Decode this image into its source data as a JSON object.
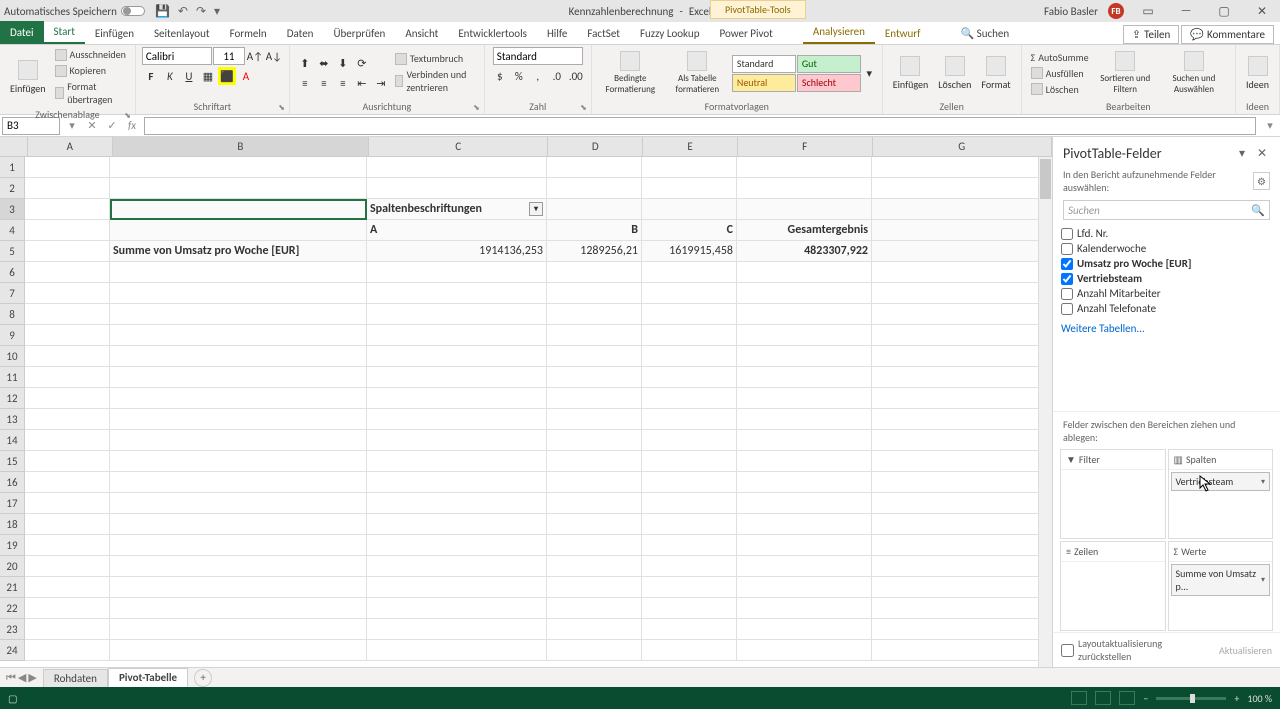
{
  "titlebar": {
    "autosave": "Automatisches Speichern",
    "docname": "Kennzahlenberechnung",
    "app": "Excel",
    "pt_tools": "PivotTable-Tools",
    "user": "Fabio Basler",
    "user_initials": "FB"
  },
  "tabs": {
    "file": "Datei",
    "items": [
      "Start",
      "Einfügen",
      "Seitenlayout",
      "Formeln",
      "Daten",
      "Überprüfen",
      "Ansicht",
      "Entwicklertools",
      "Hilfe",
      "FactSet",
      "Fuzzy Lookup",
      "Power Pivot"
    ],
    "pt_items": [
      "Analysieren",
      "Entwurf"
    ],
    "search": "Suchen",
    "share": "Teilen",
    "comments": "Kommentare"
  },
  "ribbon": {
    "clipboard": {
      "label": "Zwischenablage",
      "paste": "Einfügen",
      "cut": "Ausschneiden",
      "copy": "Kopieren",
      "fmtpaint": "Format übertragen"
    },
    "font": {
      "label": "Schriftart",
      "name": "Calibri",
      "size": "11"
    },
    "align": {
      "label": "Ausrichtung",
      "wrap": "Textumbruch",
      "merge": "Verbinden und zentrieren"
    },
    "number": {
      "label": "Zahl",
      "format": "Standard"
    },
    "styles": {
      "label": "Formatvorlagen",
      "cond": "Bedingte Formatierung",
      "astable": "Als Tabelle formatieren",
      "std": "Standard",
      "gut": "Gut",
      "neutral": "Neutral",
      "schlecht": "Schlecht"
    },
    "cells": {
      "label": "Zellen",
      "insert": "Einfügen",
      "delete": "Löschen",
      "format": "Format"
    },
    "editing": {
      "label": "Bearbeiten",
      "autosum": "AutoSumme",
      "fill": "Ausfüllen",
      "clear": "Löschen",
      "sort": "Sortieren und Filtern",
      "find": "Suchen und Auswählen"
    },
    "ideas": {
      "label": "Ideen",
      "btn": "Ideen"
    }
  },
  "fbar": {
    "cellref": "B3"
  },
  "cols": [
    "A",
    "B",
    "C",
    "D",
    "E",
    "F",
    "G"
  ],
  "rows": [
    "1",
    "2",
    "3",
    "4",
    "5",
    "6",
    "7",
    "8",
    "9",
    "10",
    "11",
    "12",
    "13",
    "14",
    "15",
    "16",
    "17",
    "18",
    "19",
    "20",
    "21",
    "22",
    "23",
    "24"
  ],
  "pivot": {
    "col_label": "Spaltenbeschriftungen",
    "col_headers": [
      "A",
      "B",
      "C",
      "Gesamtergebnis"
    ],
    "row_label": "Summe von Umsatz pro Woche [EUR]",
    "values": [
      "1914136,253",
      "1289256,21",
      "1619915,458",
      "4823307,922"
    ]
  },
  "pane": {
    "title": "PivotTable-Felder",
    "subtitle": "In den Bericht aufzunehmende Felder auswählen:",
    "search": "Suchen",
    "fields": [
      {
        "name": "Lfd. Nr.",
        "checked": false
      },
      {
        "name": "Kalenderwoche",
        "checked": false
      },
      {
        "name": "Umsatz pro Woche [EUR]",
        "checked": true
      },
      {
        "name": "Vertriebsteam",
        "checked": true
      },
      {
        "name": "Anzahl Mitarbeiter",
        "checked": false
      },
      {
        "name": "Anzahl Telefonate",
        "checked": false
      }
    ],
    "more": "Weitere Tabellen...",
    "drag_hint": "Felder zwischen den Bereichen ziehen und ablegen:",
    "zones": {
      "filter": "Filter",
      "columns": "Spalten",
      "rows": "Zeilen",
      "values": "Werte"
    },
    "col_item": "Vertriebsteam",
    "val_item": "Summe von Umsatz p...",
    "defer": "Layoutaktualisierung zurückstellen",
    "update": "Aktualisieren"
  },
  "sheets": {
    "tab1": "Rohdaten",
    "tab2": "Pivot-Tabelle"
  },
  "status": {
    "zoom": "100 %"
  }
}
